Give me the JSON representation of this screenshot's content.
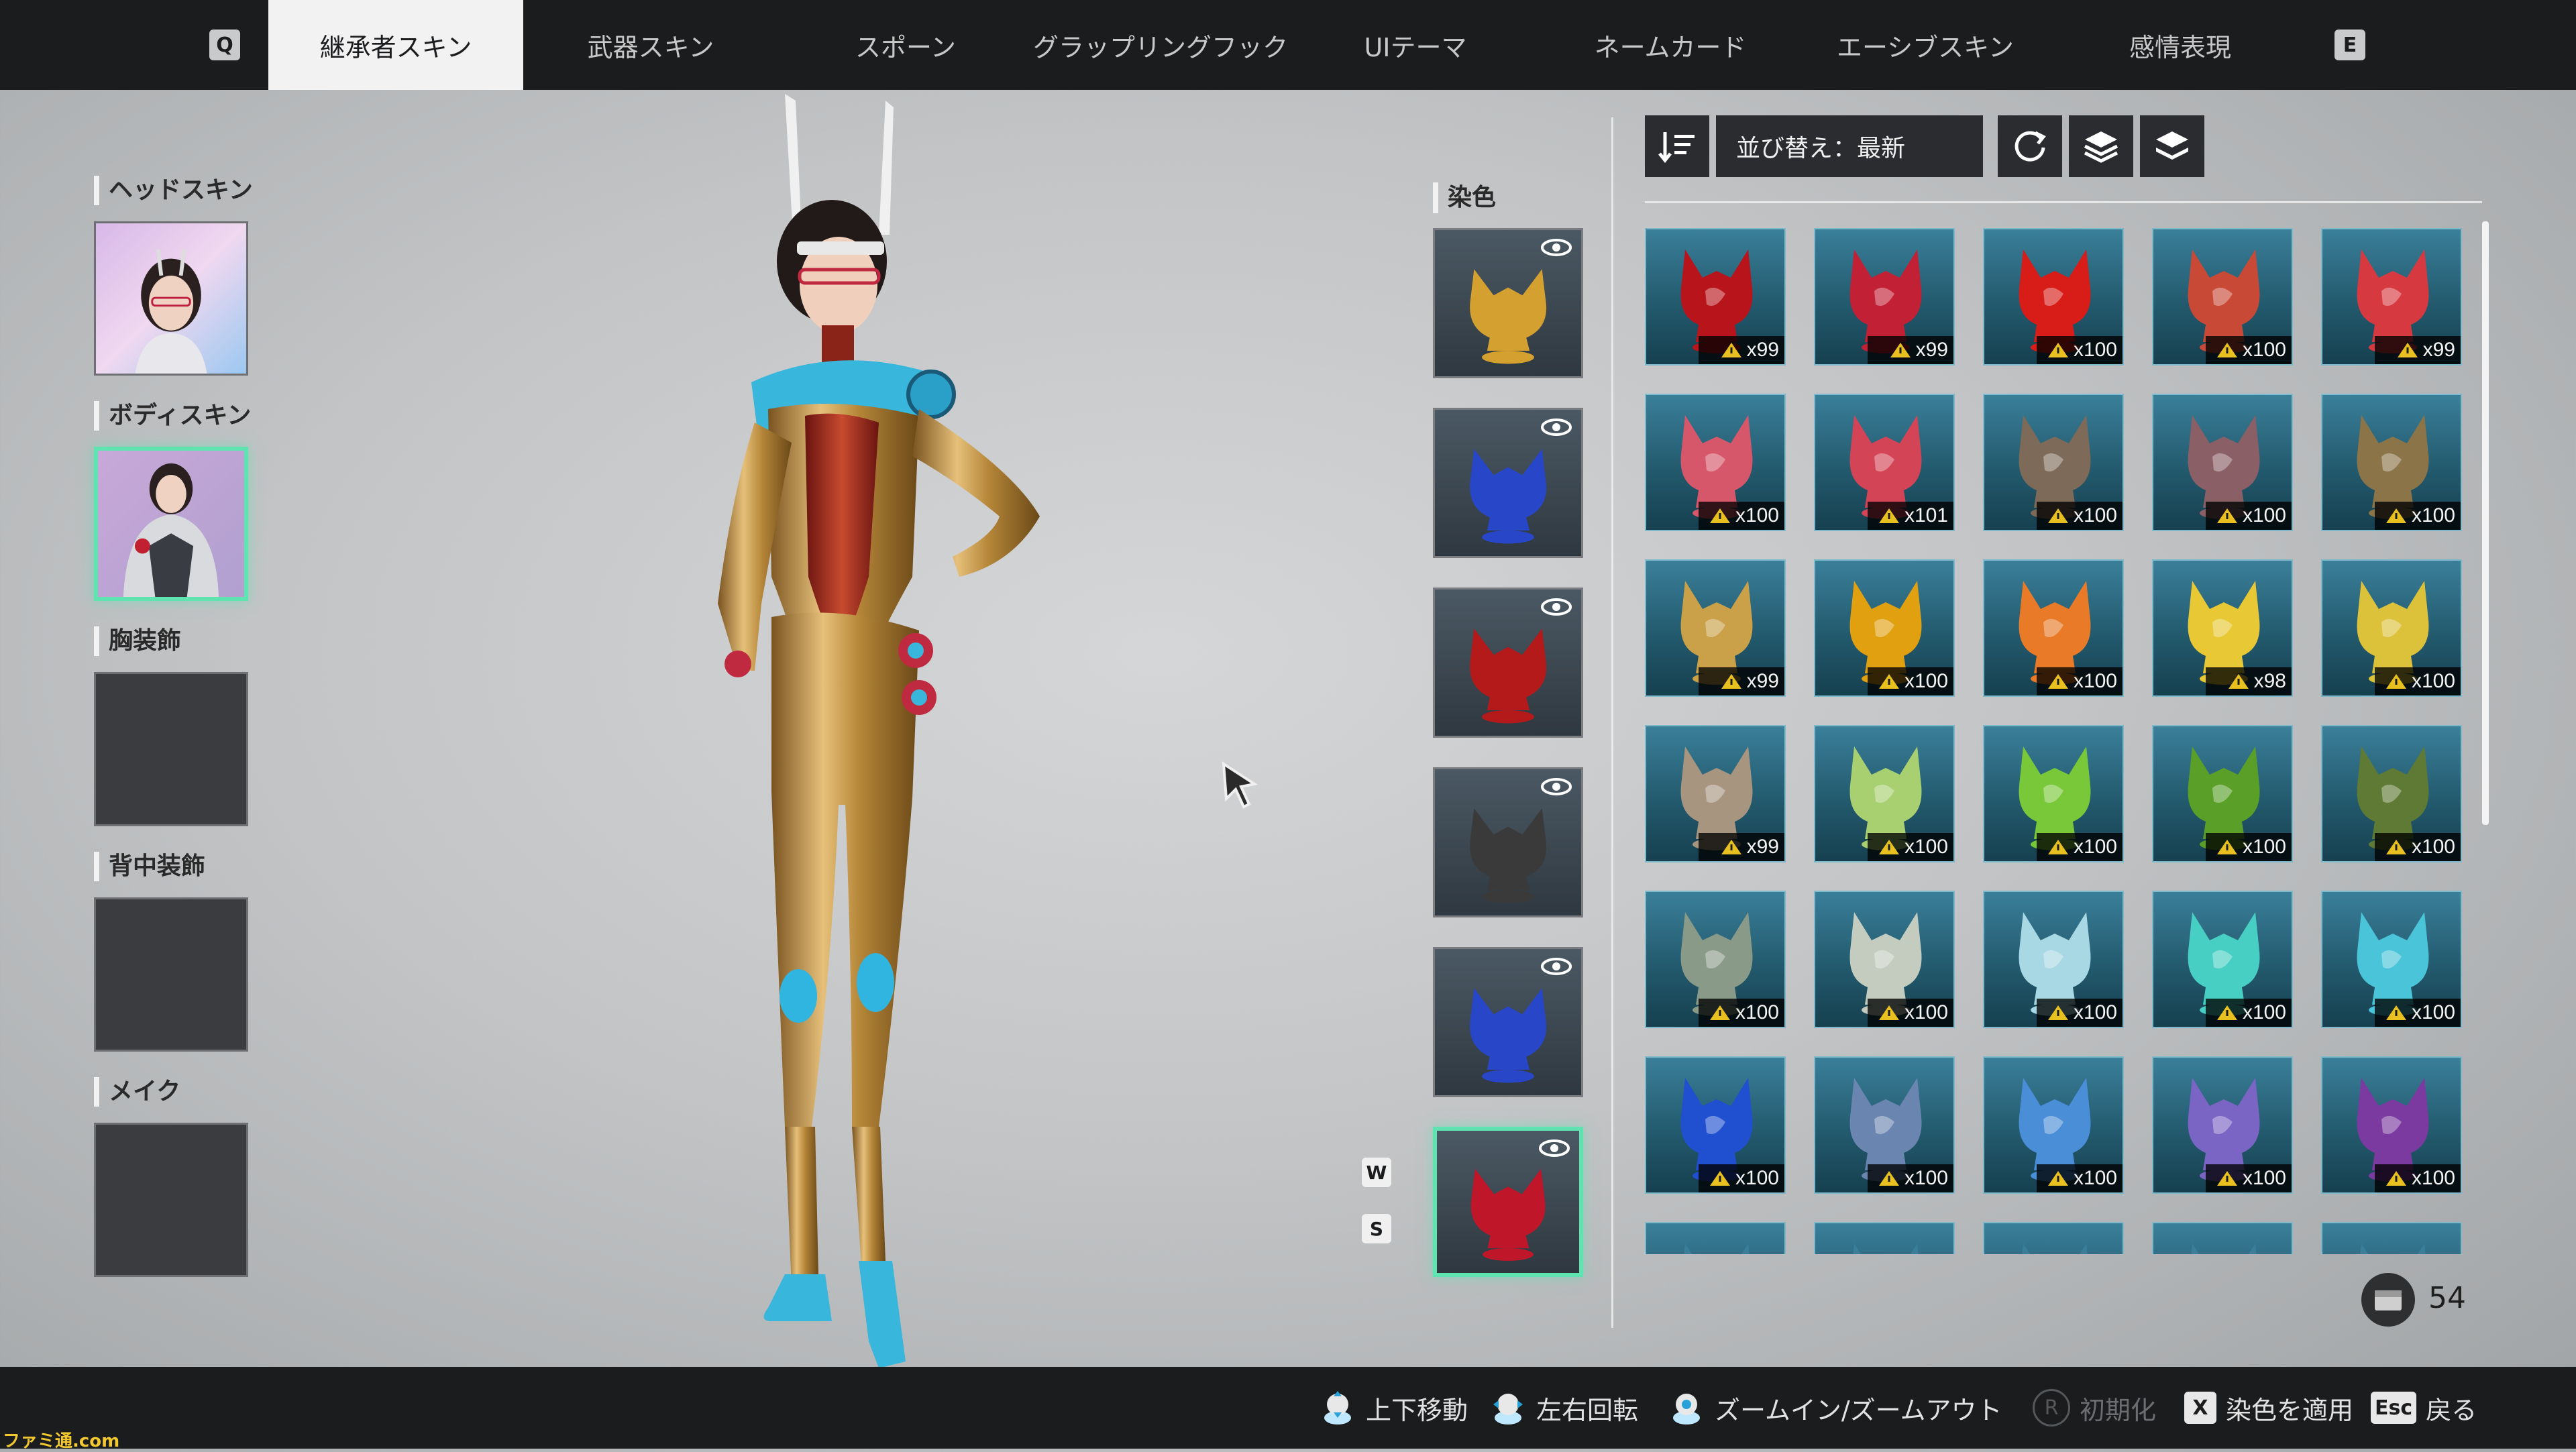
{
  "tabs": {
    "prev_key": "Q",
    "next_key": "E",
    "items": [
      {
        "label": "継承者スキン",
        "active": true
      },
      {
        "label": "武器スキン"
      },
      {
        "label": "スポーン"
      },
      {
        "label": "グラップリングフック"
      },
      {
        "label": "UIテーマ"
      },
      {
        "label": "ネームカード"
      },
      {
        "label": "エーシブスキン"
      },
      {
        "label": "感情表現"
      }
    ]
  },
  "slots": [
    {
      "label": "ヘッドスキン",
      "filled": true
    },
    {
      "label": "ボディスキン",
      "filled": true,
      "selected": true
    },
    {
      "label": "胸装飾",
      "filled": false
    },
    {
      "label": "背中装飾",
      "filled": false
    },
    {
      "label": "メイク",
      "filled": false
    }
  ],
  "dye": {
    "header": "染色",
    "slots": [
      {
        "color": "#d4a030"
      },
      {
        "color": "#2847c8"
      },
      {
        "color": "#b41a1a"
      },
      {
        "color": "#3a3a3a"
      },
      {
        "color": "#2847c8"
      },
      {
        "color": "#c0162a",
        "selected": true
      }
    ],
    "nav_up_key": "W",
    "nav_down_key": "S"
  },
  "toolbar": {
    "sort_label": "並び替え：最新",
    "icons": [
      "sort-order-icon",
      "refresh-icon",
      "layers-icon",
      "layers-alt-icon"
    ]
  },
  "dye_items": [
    {
      "color": "#b8141c",
      "qty": "x99"
    },
    {
      "color": "#c22035",
      "qty": "x99"
    },
    {
      "color": "#d81c18",
      "qty": "x100"
    },
    {
      "color": "#c84a36",
      "qty": "x100"
    },
    {
      "color": "#d63a40",
      "qty": "x99"
    },
    {
      "color": "#d6576a",
      "qty": "x100"
    },
    {
      "color": "#d44457",
      "qty": "x101"
    },
    {
      "color": "#7e6a58",
      "qty": "x100"
    },
    {
      "color": "#8a5f66",
      "qty": "x100"
    },
    {
      "color": "#8a7448",
      "qty": "x100"
    },
    {
      "color": "#caa048",
      "qty": "x99"
    },
    {
      "color": "#e0a010",
      "qty": "x100"
    },
    {
      "color": "#e87a28",
      "qty": "x100"
    },
    {
      "color": "#e8c834",
      "qty": "x98"
    },
    {
      "color": "#dcc23a",
      "qty": "x100"
    },
    {
      "color": "#a89580",
      "qty": "x99"
    },
    {
      "color": "#a8d070",
      "qty": "x100"
    },
    {
      "color": "#78c83a",
      "qty": "x100"
    },
    {
      "color": "#5aa028",
      "qty": "x100"
    },
    {
      "color": "#5e7a34",
      "qty": "x100"
    },
    {
      "color": "#8a9a88",
      "qty": "x100"
    },
    {
      "color": "#c4ccc0",
      "qty": "x100"
    },
    {
      "color": "#a8d8e4",
      "qty": "x100"
    },
    {
      "color": "#48cfc4",
      "qty": "x100"
    },
    {
      "color": "#4ac4d8",
      "qty": "x100"
    },
    {
      "color": "#2050d0",
      "qty": "x100"
    },
    {
      "color": "#6a86b0",
      "qty": "x100"
    },
    {
      "color": "#4a8ed8",
      "qty": "x100"
    },
    {
      "color": "#7a64c4",
      "qty": "x100"
    },
    {
      "color": "#7a3aa0",
      "qty": "x100"
    },
    {
      "color": "#3a7f99",
      "qty": ""
    },
    {
      "color": "#3a7f99",
      "qty": ""
    },
    {
      "color": "#3a7f99",
      "qty": ""
    },
    {
      "color": "#3a7f99",
      "qty": ""
    },
    {
      "color": "#3a7f99",
      "qty": ""
    }
  ],
  "inventory_count": "54",
  "hints": [
    {
      "icon": "stick-vertical-icon",
      "label": "上下移動"
    },
    {
      "icon": "stick-horizontal-icon",
      "label": "左右回転"
    },
    {
      "icon": "stick-press-icon",
      "label": "ズームイン/ズームアウト"
    },
    {
      "key": "R",
      "label": "初期化",
      "disabled": true
    },
    {
      "key": "X",
      "label": "染色を適用"
    },
    {
      "key": "Esc",
      "label": "戻る"
    }
  ],
  "watermark": "ファミ通.com"
}
